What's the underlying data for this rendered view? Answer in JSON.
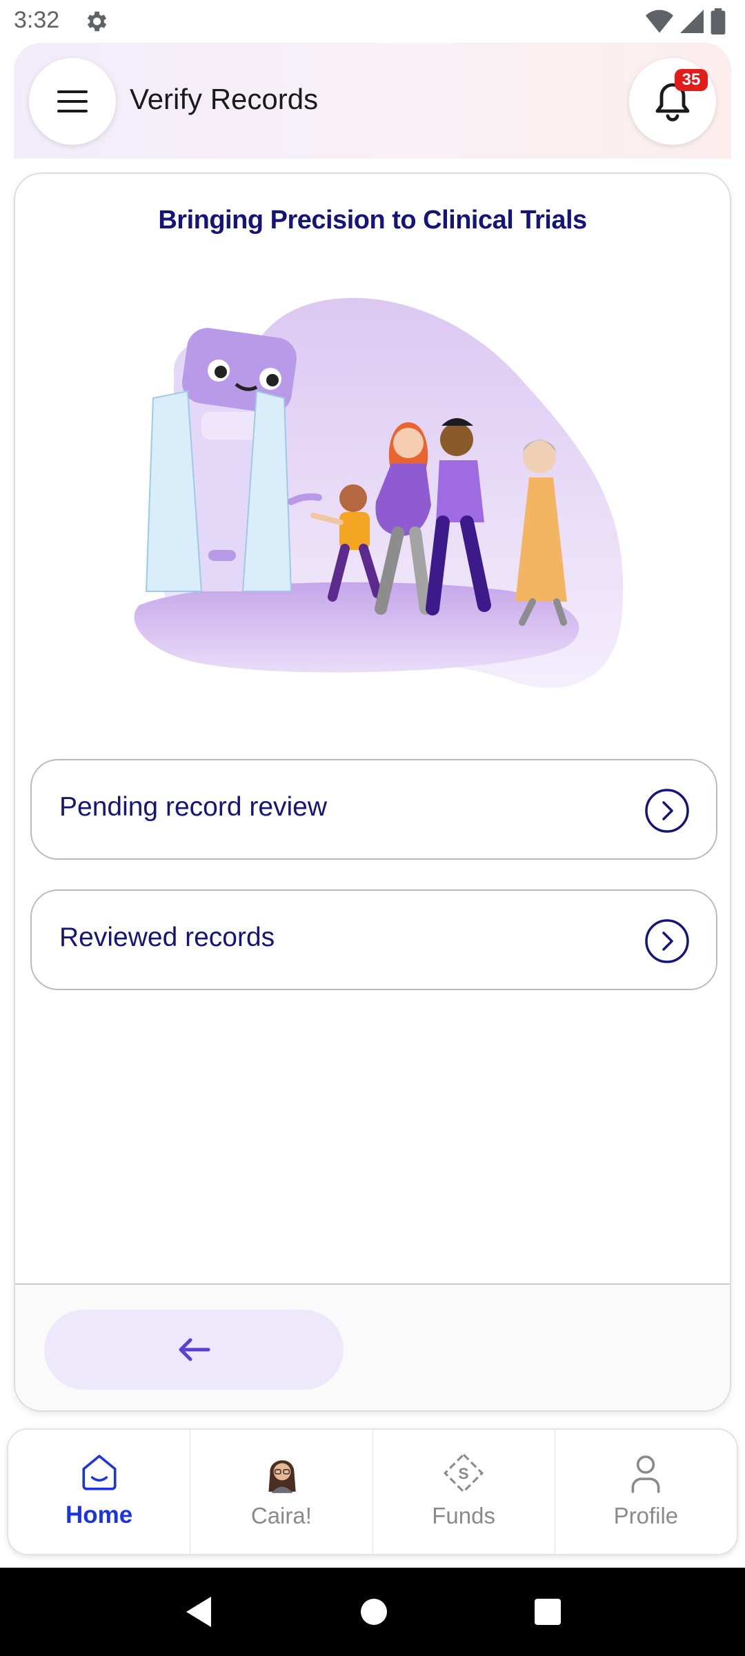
{
  "status_bar": {
    "time": "3:32"
  },
  "header": {
    "title": "Verify Records",
    "notification_count": "35"
  },
  "card": {
    "heading": "Bringing Precision to Clinical Trials",
    "items": [
      {
        "label": "Pending record review"
      },
      {
        "label": "Reviewed records"
      }
    ]
  },
  "bottom_nav": {
    "tabs": [
      {
        "label": "Home",
        "icon": "home-icon",
        "active": true
      },
      {
        "label": "Caira!",
        "icon": "avatar-icon",
        "active": false
      },
      {
        "label": "Funds",
        "icon": "funds-icon",
        "active": false
      },
      {
        "label": "Profile",
        "icon": "profile-icon",
        "active": false
      }
    ]
  },
  "colors": {
    "primary_text": "#14147a",
    "accent_blue": "#1a35e0",
    "badge_red": "#e21b1b",
    "back_button_bg": "#ede9fb",
    "arrow_purple": "#5a3fd6"
  }
}
